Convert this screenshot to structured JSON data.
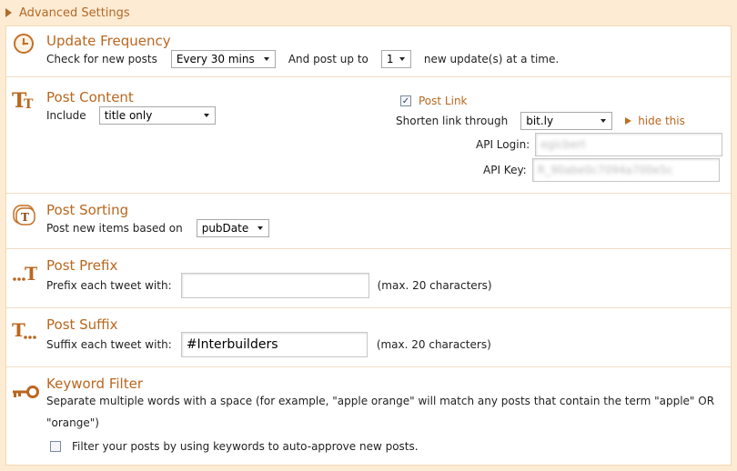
{
  "header": {
    "title": "Advanced Settings"
  },
  "update_frequency": {
    "title": "Update Frequency",
    "check_label": "Check for new posts",
    "interval": "Every 30 mins",
    "post_up_to_label": "And post up to",
    "count": "1",
    "suffix_label": "new update(s) at a time."
  },
  "post_content": {
    "title": "Post Content",
    "include_label": "Include",
    "include_value": "title only",
    "post_link_label": "Post Link",
    "post_link_checked": "✓",
    "shorten_label": "Shorten link through",
    "shortener": "bit.ly",
    "hide_label": "hide this",
    "api_login_label": "API Login:",
    "api_login_value": "egicbert",
    "api_key_label": "API Key:",
    "api_key_value": "R_90abe0c7094a700e5c"
  },
  "post_sorting": {
    "title": "Post Sorting",
    "label": "Post new items based on",
    "value": "pubDate"
  },
  "post_prefix": {
    "title": "Post Prefix",
    "label": "Prefix each tweet with:",
    "value": "",
    "hint": "(max. 20 characters)"
  },
  "post_suffix": {
    "title": "Post Suffix",
    "label": "Suffix each tweet with:",
    "value": "#Interbuilders",
    "hint": "(max. 20 characters)"
  },
  "keyword_filter": {
    "title": "Keyword Filter",
    "description_line1": "Separate multiple words with a space (for example, \"apple orange\" will match any posts that contain the term \"apple\" OR",
    "description_line2": "\"orange\")",
    "checkbox_label": "Filter your posts by using keywords to auto-approve new posts."
  }
}
